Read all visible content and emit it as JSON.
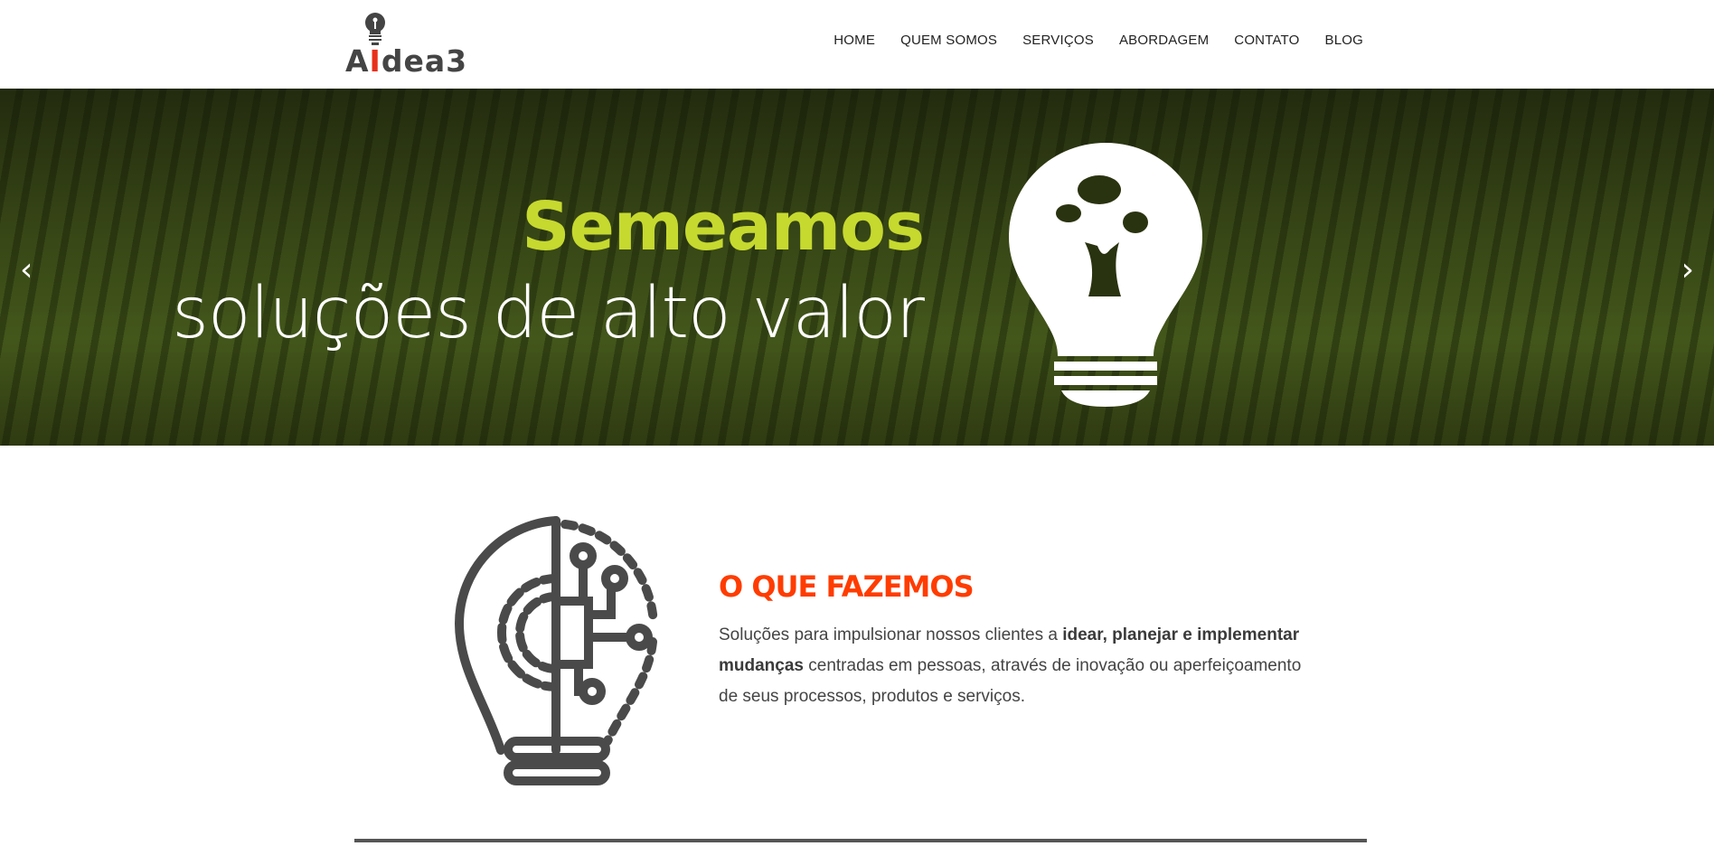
{
  "logo": {
    "text_a": "A",
    "text_i": "I",
    "text_rest": "dea3"
  },
  "nav": [
    "HOME",
    "QUEM SOMOS",
    "SERVIÇOS",
    "ABORDAGEM",
    "CONTATO",
    "BLOG"
  ],
  "hero": {
    "headline": "Semeamos",
    "subheadline": "soluções de alto valor",
    "prev": "‹",
    "next": "›",
    "accent": "#c6d92f"
  },
  "section": {
    "title": "O QUE FAZEMOS",
    "p_1": "Soluções para impulsionar nossos clientes a ",
    "p_bold": "idear, planejar e implementar mudanças",
    "p_2": " centradas em pessoas, através de inovação ou aperfeiçoamento de seus processos, produtos e serviços.",
    "accent": "#ff3c00"
  }
}
